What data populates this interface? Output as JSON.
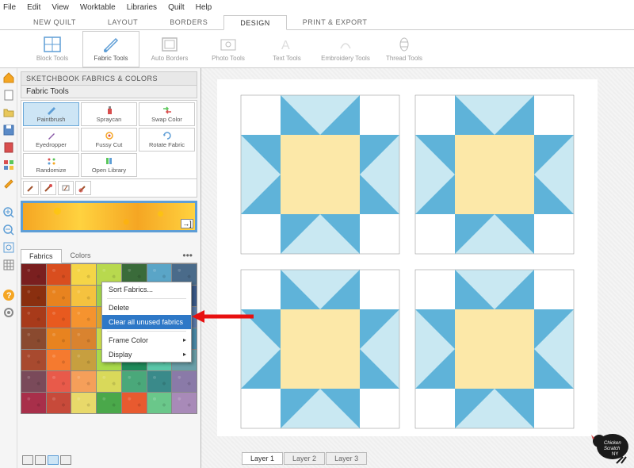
{
  "menu": [
    "File",
    "Edit",
    "View",
    "Worktable",
    "Libraries",
    "Quilt",
    "Help"
  ],
  "ribbon_tabs": [
    {
      "label": "NEW QUILT",
      "active": false
    },
    {
      "label": "LAYOUT",
      "active": false
    },
    {
      "label": "BORDERS",
      "active": false
    },
    {
      "label": "DESIGN",
      "active": true
    },
    {
      "label": "PRINT & EXPORT",
      "active": false
    }
  ],
  "ribbon_tools": [
    {
      "label": "Block Tools",
      "active": false
    },
    {
      "label": "Fabric Tools",
      "active": true
    },
    {
      "label": "Auto Borders",
      "active": false
    },
    {
      "label": "Photo Tools",
      "active": false
    },
    {
      "label": "Text Tools",
      "active": false
    },
    {
      "label": "Embroidery Tools",
      "active": false
    },
    {
      "label": "Thread Tools",
      "active": false
    }
  ],
  "panel": {
    "title": "SKETCHBOOK FABRICS & COLORS",
    "subtitle": "Fabric Tools",
    "tools": [
      {
        "label": "Paintbrush",
        "selected": true
      },
      {
        "label": "Spraycan",
        "selected": false
      },
      {
        "label": "Swap Color",
        "selected": false
      },
      {
        "label": "Eyedropper",
        "selected": false
      },
      {
        "label": "Fussy Cut",
        "selected": false
      },
      {
        "label": "Rotate Fabric",
        "selected": false
      },
      {
        "label": "Randomize",
        "selected": false
      },
      {
        "label": "Open Library",
        "selected": false
      }
    ],
    "sub_tabs": [
      {
        "label": "Fabrics",
        "active": true
      },
      {
        "label": "Colors",
        "active": false
      }
    ],
    "swatch_colors": [
      "#7a1f1f",
      "#d94e1f",
      "#f5d547",
      "#b8d94e",
      "#3a6b3a",
      "#5aa5c7",
      "#4a6b8a",
      "#8a2f0f",
      "#e8831f",
      "#f5c23f",
      "#9fcf4a",
      "#2f8a4a",
      "#6ac7d9",
      "#3a5a8a",
      "#a83a1a",
      "#e85a1f",
      "#f5932f",
      "#d9a52f",
      "#4a9f5a",
      "#8ad9e8",
      "#5a7aa8",
      "#8a4a2f",
      "#e8831f",
      "#d9832f",
      "#c7d94a",
      "#2fa86a",
      "#a8e8d9",
      "#4a8aa8",
      "#a84a2f",
      "#f57a2f",
      "#c79f3f",
      "#a8d94a",
      "#1f8a5a",
      "#5ac7a8",
      "#6a9fa8",
      "#7a4a5a",
      "#e85a4a",
      "#f59f5a",
      "#d9d95a",
      "#4aa87a",
      "#3a8a8a",
      "#8a7aa8",
      "#a82f4a",
      "#c74a3a",
      "#e8d96a",
      "#4aa84a",
      "#e85a2f",
      "#6ac78a",
      "#a88ab8"
    ]
  },
  "context_menu": [
    "Sort Fabrics...",
    "Delete",
    "Clear all unused fabrics",
    "Frame Color",
    "Display"
  ],
  "layers": [
    "Layer 1",
    "Layer 2",
    "Layer 3"
  ],
  "watermark_text": "Chicken Scratch NY"
}
